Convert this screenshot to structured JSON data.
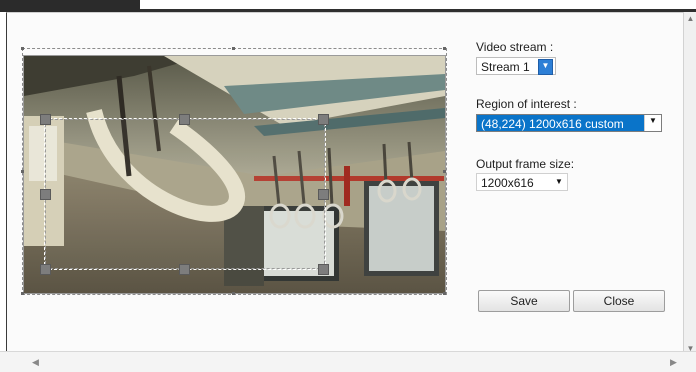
{
  "panel": {
    "video_stream_label": "Video stream :",
    "region_label": "Region of interest :",
    "output_label": "Output frame size:"
  },
  "controls": {
    "stream_value": "Stream 1",
    "region_value": "(48,224) 1200x616 custom",
    "frame_size_value": "1200x616"
  },
  "buttons": {
    "save": "Save",
    "close": "Close"
  },
  "icons": {
    "dropdown": "▼",
    "scroll_up": "▲",
    "scroll_down": "▼",
    "scroll_left": "◀",
    "scroll_right": "▶"
  },
  "colors": {
    "selection_blue": "#0a74c9",
    "stream_arrow_blue": "#2d7fd6"
  }
}
